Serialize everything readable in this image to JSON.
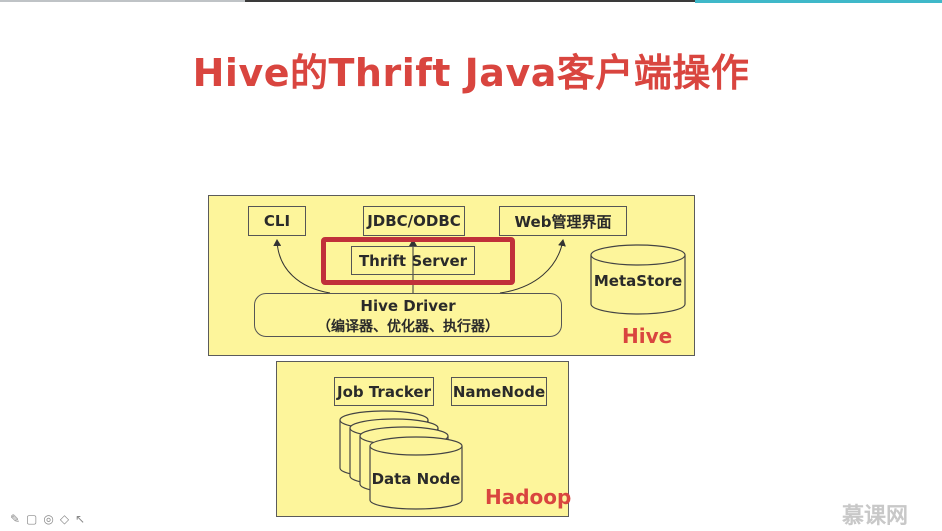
{
  "title": "Hive的Thrift Java客户端操作",
  "hive": {
    "label": "Hive",
    "cli": "CLI",
    "jdbc": "JDBC/ODBC",
    "web": "Web管理界面",
    "thrift": "Thrift Server",
    "metastore": "MetaStore",
    "driver_line1": "Hive Driver",
    "driver_line2": "（编译器、优化器、执行器）"
  },
  "hadoop": {
    "label": "Hadoop",
    "jobtracker": "Job Tracker",
    "namenode": "NameNode",
    "datanode": "Data Node"
  },
  "brand": "慕课网",
  "colors": {
    "title": "#d9453f",
    "panel": "#fdf59b",
    "highlight": "#c0303a"
  }
}
